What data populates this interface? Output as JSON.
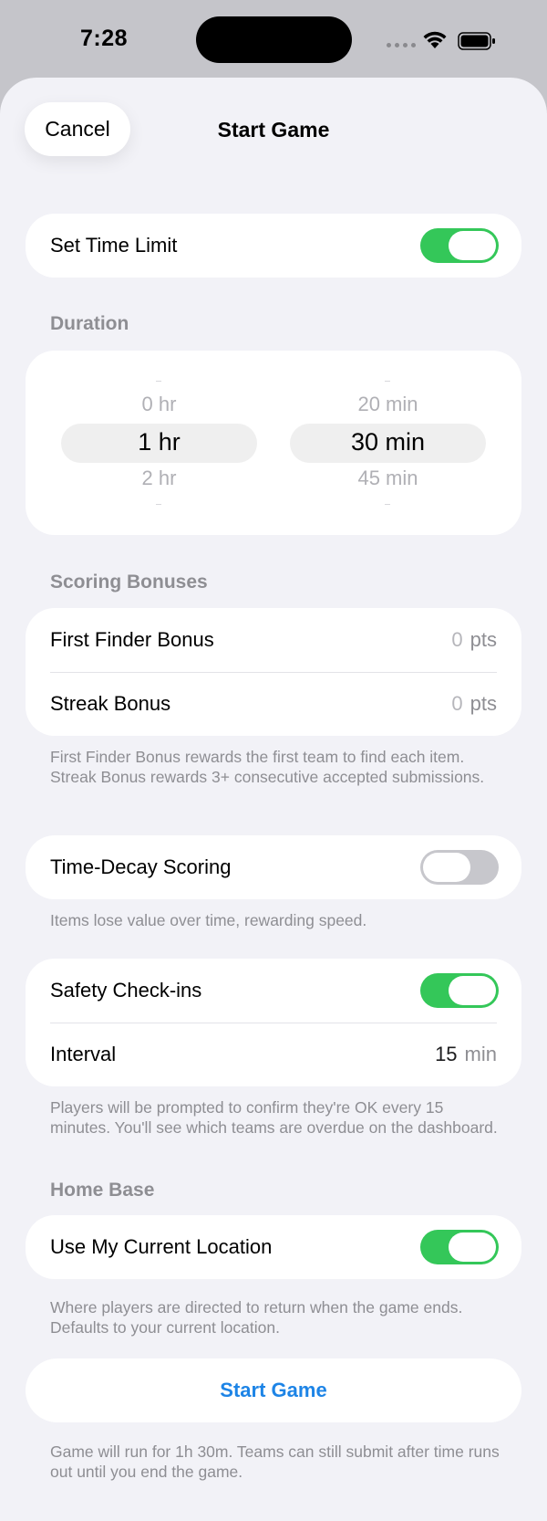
{
  "status": {
    "time": "7:28"
  },
  "header": {
    "cancel_label": "Cancel",
    "title": "Start Game"
  },
  "time_limit": {
    "label": "Set Time Limit",
    "enabled": true
  },
  "duration": {
    "header": "Duration",
    "hours": {
      "above": "0 hr",
      "selected": "1 hr",
      "below": "2 hr"
    },
    "minutes": {
      "above": "20 min",
      "selected": "30 min",
      "below": "45 min"
    }
  },
  "scoring": {
    "header": "Scoring Bonuses",
    "first_finder": {
      "label": "First Finder Bonus",
      "value": "0",
      "unit": "pts"
    },
    "streak": {
      "label": "Streak Bonus",
      "value": "0",
      "unit": "pts"
    },
    "footnote": "First Finder Bonus rewards the first team to find each item. Streak Bonus rewards 3+ consecutive accepted submissions."
  },
  "time_decay": {
    "label": "Time-Decay Scoring",
    "enabled": false,
    "footnote": "Items lose value over time, rewarding speed."
  },
  "safety": {
    "label": "Safety Check-ins",
    "enabled": true,
    "interval_label": "Interval",
    "interval_value": "15",
    "interval_unit": "min",
    "footnote": "Players will be prompted to confirm they're OK every 15 minutes. You'll see which teams are overdue on the dashboard."
  },
  "home_base": {
    "header": "Home Base",
    "label": "Use My Current Location",
    "enabled": true,
    "footnote": "Where players are directed to return when the game ends. Defaults to your current location."
  },
  "start": {
    "label": "Start Game",
    "footnote": "Game will run for 1h 30m. Teams can still submit after time runs out until you end the game."
  },
  "colors": {
    "accent": "#1d84e6",
    "toggle_on": "#34c759",
    "toggle_off": "#c7c7cc",
    "background": "#f2f2f7"
  }
}
